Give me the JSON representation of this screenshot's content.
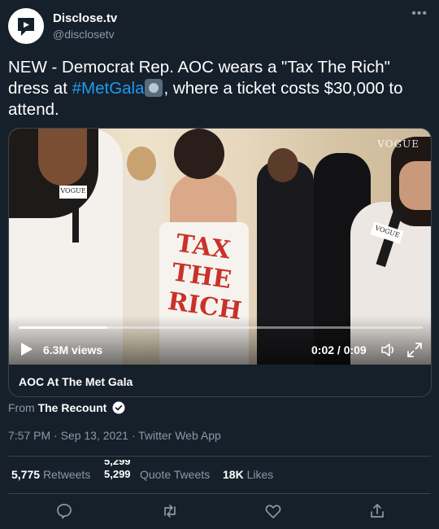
{
  "author": {
    "name": "Disclose.tv",
    "handle": "@disclosetv"
  },
  "tweet": {
    "text_before": "NEW - Democrat Rep. AOC wears a \"Tax The Rich\" dress at ",
    "hashtag": "#MetGala",
    "emoji": "camera-flash-emoji",
    "text_after": ", where a ticket costs $30,000 to attend."
  },
  "media": {
    "video_overlay_text": {
      "watermark": "VOGUE",
      "mic_flag_left": "VOGUE",
      "mic_flag_right": "VOGUE",
      "dress_text": "TAX THE RICH"
    },
    "views": "6.3M views",
    "timecode": "0:02 / 0:09",
    "progress_fraction": 0.22,
    "title": "AOC At The Met Gala"
  },
  "source": {
    "label": "From",
    "name": "The Recount"
  },
  "meta": {
    "time": "7:57 PM",
    "date": "Sep 13, 2021",
    "client": "Twitter Web App",
    "separator": "·"
  },
  "stats": {
    "retweets_count": "5,775",
    "retweets_label": "Retweets",
    "quote_count_old": "5,299",
    "quote_count_new": "5,299",
    "quote_label": "Quote Tweets",
    "likes_count": "18K",
    "likes_label": "Likes"
  },
  "colors": {
    "background": "#15202b",
    "accent": "#1d9bf0",
    "secondary_text": "#8b98a5",
    "border": "#38444d",
    "dress_text": "#c8322a"
  }
}
